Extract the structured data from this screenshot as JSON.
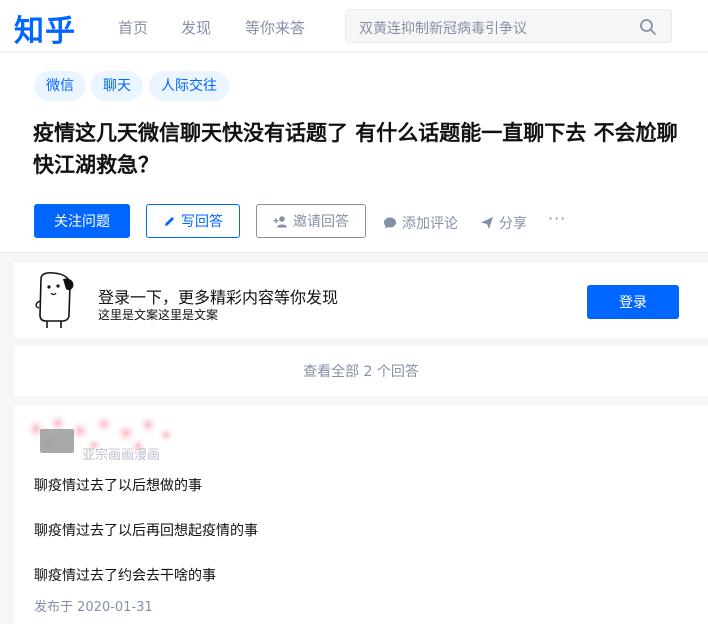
{
  "header": {
    "logo": "知乎",
    "nav": [
      "首页",
      "发现",
      "等你来答"
    ],
    "search_placeholder": "双黄连抑制新冠病毒引争议"
  },
  "question": {
    "tags": [
      "微信",
      "聊天",
      "人际交往"
    ],
    "title": "疫情这几天微信聊天快没有话题了 有什么话题能一直聊下去 不会尬聊 快江湖救急？",
    "follow_label": "关注问题",
    "write_label": "写回答",
    "invite_label": "邀请回答",
    "comment_label": "添加评论",
    "share_label": "分享",
    "more_label": "···"
  },
  "login_banner": {
    "title": "登录一下，更多精彩内容等你发现",
    "subtitle": "这里是文案这里是文案",
    "button_label": "登录"
  },
  "view_all": "查看全部 2 个回答",
  "answer": {
    "author": "亚宗画画漫画",
    "lines": [
      "聊疫情过去了以后想做的事",
      "聊疫情过去了以后再回想起疫情的事",
      "聊疫情过去了约会去干啥的事"
    ],
    "published": "发布于 2020-01-31"
  },
  "colors": {
    "brand": "#0066ff",
    "muted": "#8590a6",
    "tag_bg": "#ebf5ff"
  },
  "icons": [
    "search-icon",
    "pencil-icon",
    "add-user-icon",
    "comment-icon",
    "share-icon",
    "more-icon"
  ]
}
